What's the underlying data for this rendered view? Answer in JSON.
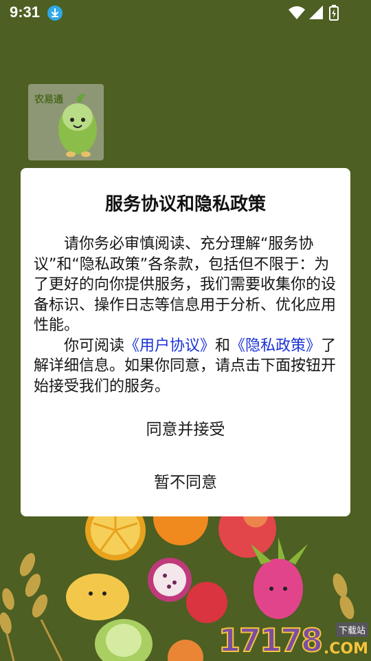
{
  "status_bar": {
    "time": "9:31",
    "icons": [
      "download-icon",
      "wifi-icon",
      "signal-icon",
      "battery-icon"
    ]
  },
  "splash": {
    "logo_text": "农易通"
  },
  "dialog": {
    "title": "服务协议和隐私政策",
    "para1": "请你务必审慎阅读、充分理解“服务协议”和“隐私政策”各条款，包括但不限于：为了更好的向你提供服务，我们需要收集你的设备标识、操作日志等信息用于分析、优化应用性能。",
    "para2_before": "你可阅读",
    "link_user_agreement": "《用户协议》",
    "para2_and": "和",
    "link_privacy_policy": "《隐私政策》",
    "para2_after": "了解详细信息。如果你同意，请点击下面按钮开始接受我们的服务。",
    "accept_label": "同意并接受",
    "decline_label": "暂不同意"
  },
  "watermark": {
    "number": "17178",
    "tag": "下载站",
    "suffix": ".COM"
  },
  "colors": {
    "background": "#4d5f22",
    "link": "#1a33d6",
    "dialog": "#ffffff"
  }
}
